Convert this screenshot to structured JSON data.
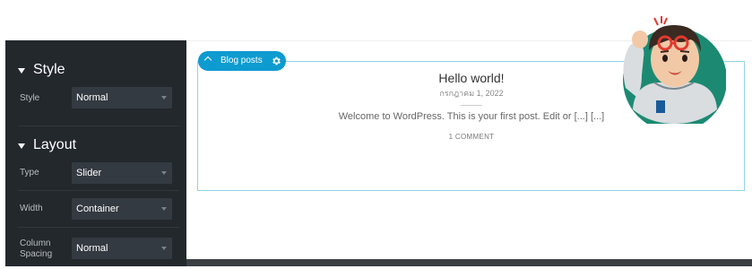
{
  "panel": {
    "style_section": {
      "title": "Style"
    },
    "layout_section": {
      "title": "Layout"
    },
    "style_row": {
      "label": "Style",
      "value": "Normal"
    },
    "type_row": {
      "label": "Type",
      "value": "Slider"
    },
    "width_row": {
      "label": "Width",
      "value": "Container"
    },
    "spacing_row": {
      "label": "Column Spacing",
      "value": "Normal"
    }
  },
  "widget": {
    "tag_label": "Blog posts",
    "accent_color": "#0e9bd0"
  },
  "post": {
    "title": "Hello world!",
    "date": "กรกฎาคม 1, 2022",
    "excerpt": "Welcome to WordPress. This is your first post. Edit or [...] [...]",
    "comments": "1 COMMENT"
  },
  "icons": {
    "collapse": "chevron-up-icon",
    "settings": "gear-icon",
    "section_toggle": "caret-down-icon"
  }
}
